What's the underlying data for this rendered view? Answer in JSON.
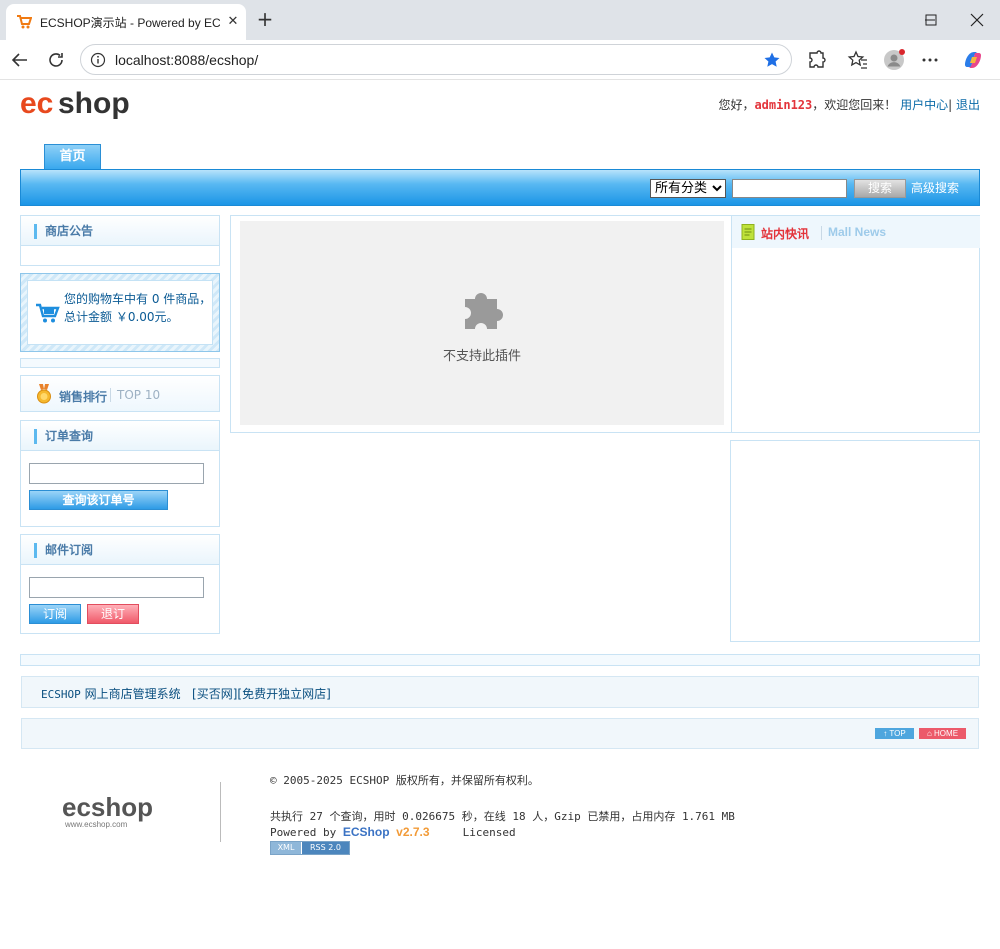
{
  "browser": {
    "tab_title": "ECSHOP演示站 - Powered by ECShop",
    "url": "localhost:8088/ecshop/"
  },
  "header": {
    "greeting": "您好，",
    "username": "admin123",
    "welcome": "，欢迎您回来！",
    "user_center": "用户中心",
    "separator": "|",
    "logout": "退出"
  },
  "nav": {
    "home_tab": "首页"
  },
  "search": {
    "category_selected": "所有分类",
    "keyword": "",
    "button": "搜索",
    "advanced": "高级搜索"
  },
  "sidebar": {
    "notice_title": "商店公告",
    "cart_text": "您的购物车中有 0 件商品，总计金额 ￥0.00元。",
    "top10_title": "销售排行",
    "top10_sub": "TOP 10",
    "order_title": "订单查询",
    "order_button": "查询该订单号",
    "mail_title": "邮件订阅",
    "subscribe_button": "订阅",
    "unsubscribe_button": "退订"
  },
  "main": {
    "plugin_message": "不支持此插件",
    "news_title": "站内快讯",
    "news_title_en": "Mall News"
  },
  "links": {
    "logo_alt": "ECSHOP",
    "system_link": "网上商店管理系统",
    "link1": "[买否网]",
    "link2": "[免费开独立网店]"
  },
  "totop": {
    "top_label": "↑ TOP",
    "home_label": "⌂ HOME"
  },
  "footer": {
    "copyright": "© 2005-2025 ECSHOP 版权所有，并保留所有权利。",
    "stats": "共执行 27 个查询，用时 0.026675 秒，在线 18 人，Gzip 已禁用，占用内存 1.761 MB",
    "powered_by": "Powered by ",
    "brand": "ECShop",
    "version": "v2.7.3",
    "licensed": "Licensed",
    "xml_badge": "XML",
    "rss_badge": "RSS 2.0",
    "logo_url": "www.ecshop.com"
  },
  "colors": {
    "accent_blue": "#1b95e6",
    "username_red": "#e3343b",
    "link_blue": "#0a6aa8"
  }
}
